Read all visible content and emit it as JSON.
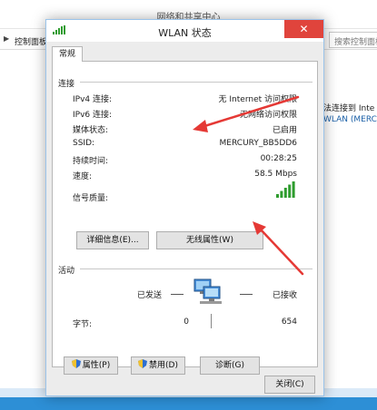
{
  "background": {
    "window_title": "网络和共享中心",
    "back_glyph": "▶",
    "breadcrumb": "控制面板",
    "search_placeholder": "搜索控制面板",
    "right_text": "法连接到 Inte",
    "right_link": "WLAN (MERCU"
  },
  "dialog": {
    "title": "WLAN 状态",
    "close_glyph": "✕",
    "tab_general": "常规",
    "connection": {
      "section_label": "连接",
      "rows": [
        {
          "label": "IPv4 连接:",
          "value": "无 Internet 访问权限"
        },
        {
          "label": "IPv6 连接:",
          "value": "无网络访问权限"
        },
        {
          "label": "媒体状态:",
          "value": "已启用"
        },
        {
          "label": "SSID:",
          "value": "MERCURY_BB5DD6"
        },
        {
          "label": "持续时间:",
          "value": "00:28:25"
        },
        {
          "label": "速度:",
          "value": "58.5 Mbps"
        }
      ],
      "signal_label": "信号质量:",
      "signal_bars_filled": 5,
      "signal_bars_total": 5
    },
    "details_button": "详细信息(E)...",
    "wireless_button": "无线属性(W)",
    "activity": {
      "section_label": "活动",
      "sent_label": "已发送",
      "received_label": "已接收",
      "bytes_label": "字节:",
      "bytes_sent": "0",
      "bytes_received": "654"
    },
    "properties_button": "属性(P)",
    "disable_button": "禁用(D)",
    "diagnose_button": "诊断(G)",
    "close_button": "关闭(C)"
  },
  "colors": {
    "accent_border": "#9bc4ea",
    "close_red": "#e0443c",
    "signal_green": "#2e9c2e",
    "arrow_red": "#e53935",
    "taskbar_blue": "#2d8fd6"
  }
}
